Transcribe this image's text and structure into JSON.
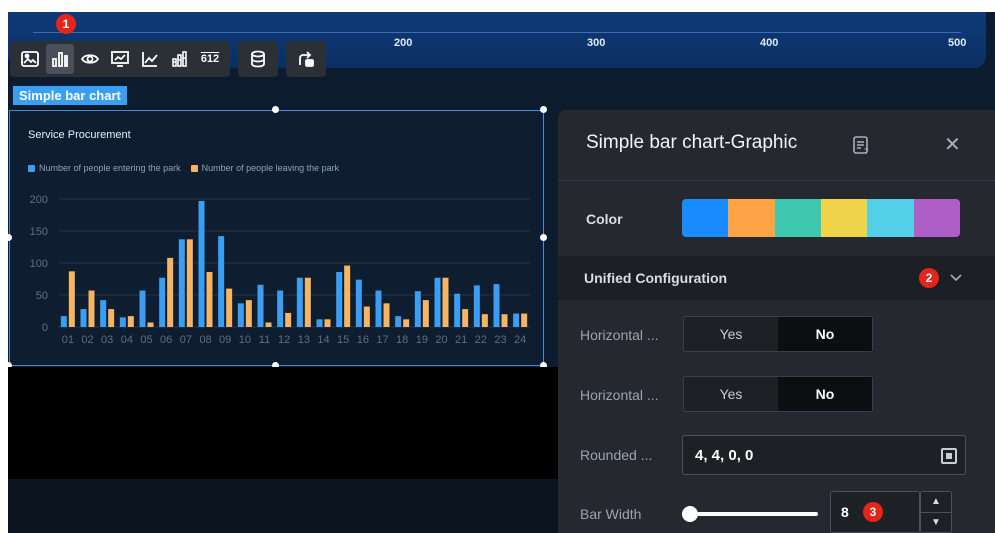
{
  "ruler": {
    "labels": [
      "200",
      "300",
      "400",
      "500"
    ]
  },
  "toolbar": {
    "groups": [
      [
        "image-icon",
        "bar-chart-icon",
        "eye-icon",
        "line-chart-icon",
        "trend-icon",
        "stacked-bar-icon",
        "number-icon"
      ],
      [
        "database-icon"
      ],
      [
        "transfer-icon"
      ]
    ],
    "number_label": "612"
  },
  "badges": {
    "b1": "1",
    "b2": "2",
    "b3": "3"
  },
  "component_tag": "Simple bar chart",
  "chart_data": {
    "type": "bar",
    "title": "Service Procurement",
    "categories": [
      "01",
      "02",
      "03",
      "04",
      "05",
      "06",
      "07",
      "08",
      "09",
      "10",
      "11",
      "12",
      "13",
      "14",
      "15",
      "16",
      "17",
      "18",
      "19",
      "20",
      "21",
      "22",
      "23",
      "24"
    ],
    "series": [
      {
        "name": "Number of people entering the park",
        "color": "#3a9ef2",
        "values": [
          17,
          28,
          42,
          15,
          57,
          77,
          137,
          197,
          142,
          37,
          66,
          57,
          77,
          12,
          86,
          74,
          57,
          17,
          56,
          77,
          52,
          65,
          67,
          21
        ]
      },
      {
        "name": "Number of people leaving the park",
        "color": "#f7b563",
        "values": [
          87,
          57,
          28,
          17,
          7,
          108,
          137,
          86,
          60,
          42,
          7,
          22,
          77,
          12,
          96,
          32,
          37,
          12,
          42,
          77,
          28,
          20,
          20,
          21
        ]
      }
    ],
    "ylim": [
      0,
      200
    ],
    "yticks": [
      "200",
      "150",
      "100",
      "50",
      "0"
    ],
    "grid": true,
    "legend_position": "top-left",
    "colors": {
      "entering": "#3a9ef2",
      "leaving": "#f7b563"
    }
  },
  "panel": {
    "title": "Simple bar chart-Graphic",
    "color_label": "Color",
    "palette": [
      "#1a8cff",
      "#ffa347",
      "#3ec8b0",
      "#f0d44a",
      "#54cfe8",
      "#ae5fc7"
    ],
    "section_title": "Unified Configuration",
    "fields": {
      "horizontal1": {
        "label": "Horizontal ...",
        "yes": "Yes",
        "no": "No"
      },
      "horizontal2": {
        "label": "Horizontal ...",
        "yes": "Yes",
        "no": "No"
      },
      "rounded": {
        "label": "Rounded ...",
        "value": "4,  4,  0,  0"
      },
      "bar_width": {
        "label": "Bar Width",
        "value": "8",
        "slider_fraction": 0.04
      }
    }
  }
}
